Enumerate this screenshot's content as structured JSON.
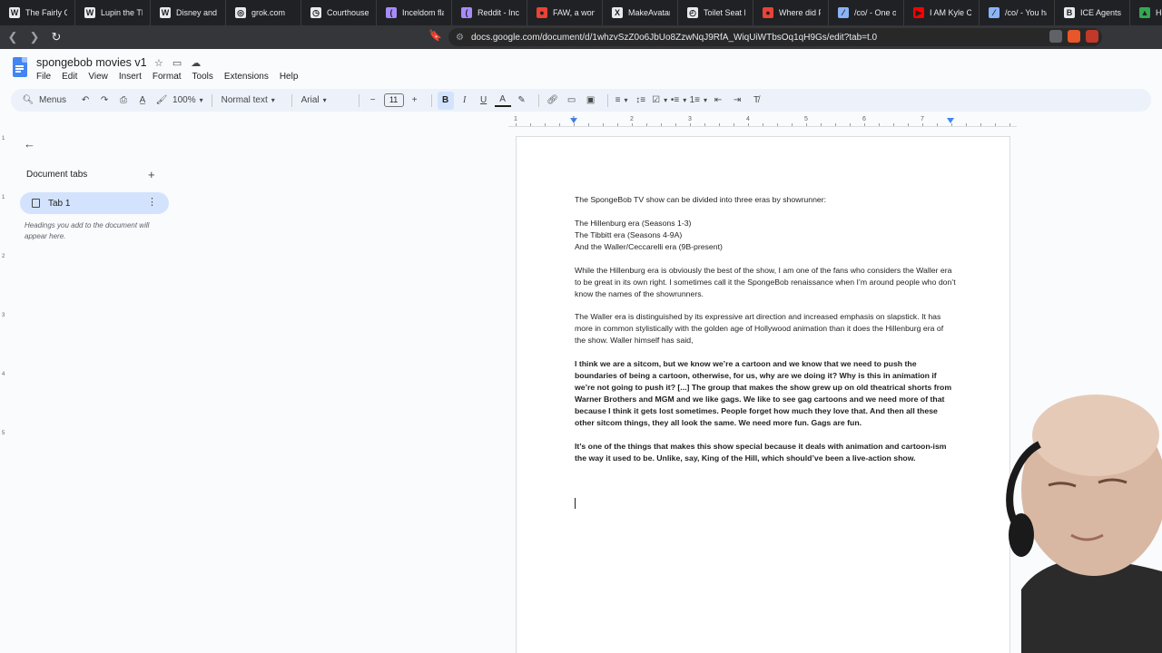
{
  "browser": {
    "tabs": [
      {
        "title": "The Fairly Odd",
        "color": "#e8eaed",
        "glyph": "W"
      },
      {
        "title": "Lupin the Thi",
        "color": "#e8eaed",
        "glyph": "W"
      },
      {
        "title": "Disney and Fl",
        "color": "#e8eaed",
        "glyph": "W"
      },
      {
        "title": "grok.com",
        "color": "#e8eaed",
        "glyph": "◎"
      },
      {
        "title": "Courthouse S",
        "color": "#e8eaed",
        "glyph": "◷"
      },
      {
        "title": "Incel­dom flag",
        "color": "#a78bfa",
        "glyph": "("
      },
      {
        "title": "Reddit - Incel",
        "color": "#a78bfa",
        "glyph": "("
      },
      {
        "title": "FAW, a wome",
        "color": "#ea4335",
        "glyph": "●"
      },
      {
        "title": "MakeAvatar",
        "color": "#e8eaed",
        "glyph": "X"
      },
      {
        "title": "Toilet Seat Et",
        "color": "#e8eaed",
        "glyph": "◴"
      },
      {
        "title": "Where did Pr",
        "color": "#ea4335",
        "glyph": "●"
      },
      {
        "title": "/co/ - One of",
        "color": "#8ab4f8",
        "glyph": "⁄"
      },
      {
        "title": "I AM Kyle Ca",
        "color": "#ff0000",
        "glyph": "▶"
      },
      {
        "title": "/co/ - You ha",
        "color": "#8ab4f8",
        "glyph": "⁄"
      },
      {
        "title": "ICE Agents In",
        "color": "#e8eaed",
        "glyph": "B"
      },
      {
        "title": "Hom",
        "color": "#34a853",
        "glyph": "▲"
      }
    ],
    "url": "docs.google.com/document/d/1whzvSzZ0o6JbUo8ZzwNqJ9RfA_WiqUiWTbsOq1qH9Gs/edit?tab=t.0"
  },
  "doc": {
    "title": "spongebob movies v1",
    "menu": [
      "File",
      "Edit",
      "View",
      "Insert",
      "Format",
      "Tools",
      "Extensions",
      "Help"
    ]
  },
  "toolbar": {
    "search_label": "Menus",
    "zoom": "100%",
    "style": "Normal text",
    "font": "Arial",
    "font_size": "11"
  },
  "ruler": {
    "numbers": [
      "1",
      "1",
      "2",
      "3",
      "4",
      "5",
      "6",
      "7"
    ]
  },
  "vruler": {
    "numbers": [
      "1",
      "1",
      "2",
      "3",
      "4",
      "5"
    ]
  },
  "sidebar": {
    "heading": "Document tabs",
    "tab_label": "Tab 1",
    "hint": "Headings you add to the document will appear here."
  },
  "content": {
    "p1": "The SpongeBob TV show can be divided into three eras by showrunner:",
    "eras": [
      "The Hillenburg era (Seasons 1-3)",
      "The Tibbitt era (Seasons 4-9A)",
      "And the Waller/Ceccarelli era (9B-present)"
    ],
    "p2": "While the Hillenburg era is obviously the best of the show, I am one of the fans who considers the Waller era to be great in its own right. I sometimes call it the SpongeBob renaissance when I’m around people who don’t know the names of the showrunners.",
    "p3": "The Waller era is distinguished by its expressive art direction and increased emphasis on slapstick. It has more in common stylistically with the golden age of Hollywood animation than it does the Hillenburg era of the show. Waller himself has said,",
    "quote1": "I think we are a sitcom, but we know we’re a cartoon and we know that we need to push the boundaries of being a cartoon, otherwise, for us, why are we doing it? Why is this in animation if we’re not going to push it? [...] The group that makes the show grew up on old theatrical shorts from Warner Brothers and MGM and we like gags. We like to see gag cartoons and we need more of that because I think it gets lost sometimes. People forget how much they love that. And then all these other sitcom things, they all look the same. We need more fun. Gags are fun.",
    "quote2": "It’s one of the things that makes this show special because it deals with animation and cartoon-ism the way it used to be. Unlike, say, King of the Hill, which should’ve been a live-action show."
  }
}
